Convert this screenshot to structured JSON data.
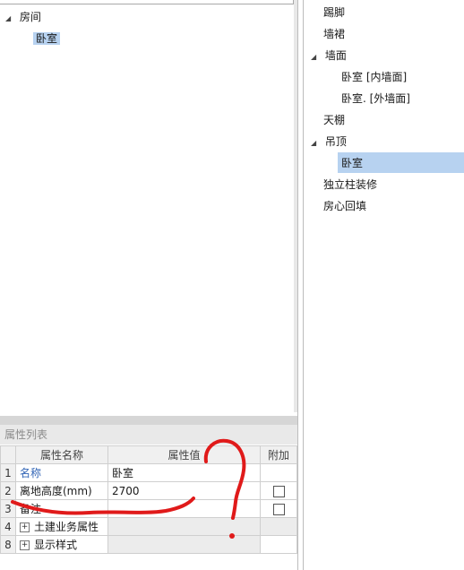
{
  "left_tree": {
    "root_label": "房间",
    "child_label": "卧室"
  },
  "property_panel": {
    "title": "属性列表",
    "columns": {
      "index": "",
      "name": "属性名称",
      "value": "属性值",
      "extra": "附加"
    },
    "rows": [
      {
        "index": "1",
        "name": "名称",
        "value": "卧室",
        "extra_checkbox": false
      },
      {
        "index": "2",
        "name": "离地高度(mm)",
        "value": "2700",
        "extra_checkbox": true
      },
      {
        "index": "3",
        "name": "备注",
        "value": "",
        "extra_checkbox": true
      },
      {
        "index": "4",
        "name": "土建业务属性",
        "value": "",
        "expandable": true
      },
      {
        "index": "8",
        "name": "显示样式",
        "value": "",
        "expandable": true
      }
    ]
  },
  "right_tree": {
    "items": [
      {
        "label": "踢脚"
      },
      {
        "label": "墙裙"
      },
      {
        "label": "墙面",
        "expanded": true
      },
      {
        "label": "卧室 [内墙面]"
      },
      {
        "label": "卧室. [外墙面]"
      },
      {
        "label": "天棚"
      },
      {
        "label": "吊顶",
        "expanded": true
      },
      {
        "label": "卧室",
        "selected": true
      },
      {
        "label": "独立柱装修"
      },
      {
        "label": "房心回填"
      }
    ]
  },
  "colors": {
    "selection": "#b7d2f0",
    "link_blue": "#2f63b5",
    "annotation_red": "#e01a1a"
  }
}
